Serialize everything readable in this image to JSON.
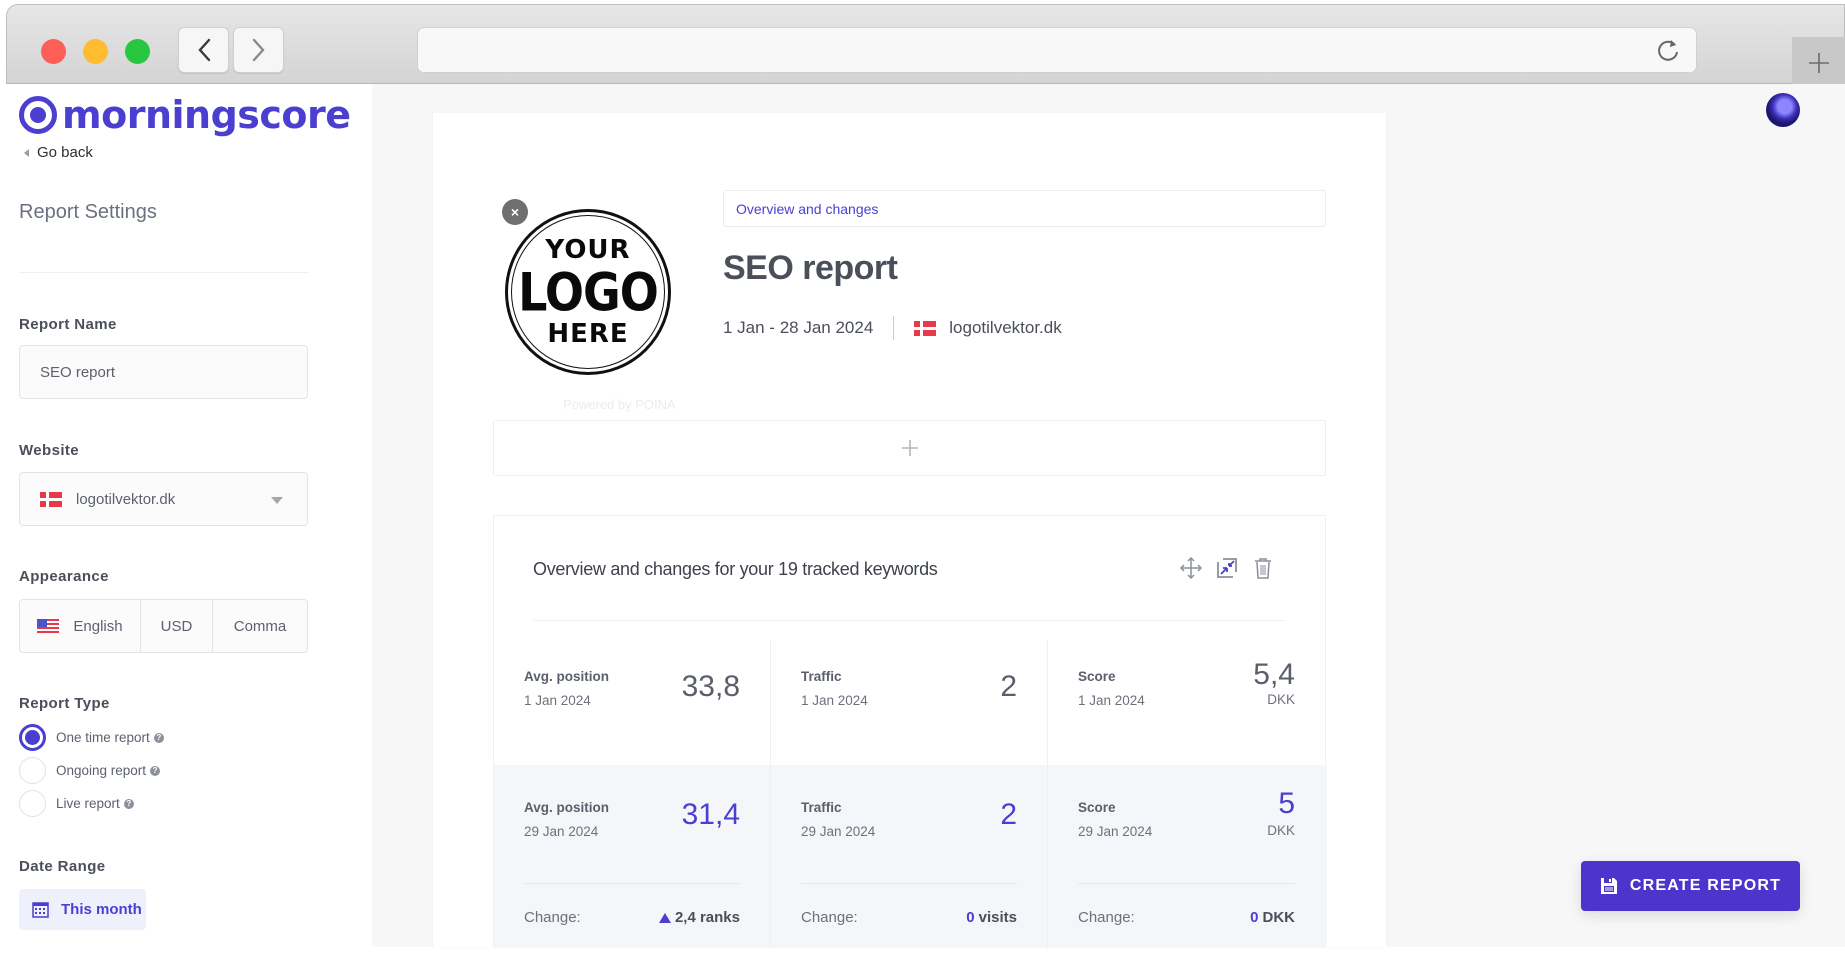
{
  "browser": {
    "back_icon": "chevron-left-icon",
    "forward_icon": "chevron-right-icon",
    "address_value": "",
    "reload_icon": "reload-icon",
    "new_tab_icon": "plus-icon"
  },
  "sidebar": {
    "brand": "morningscore",
    "go_back": "Go back",
    "section_title": "Report Settings",
    "report_name": {
      "label": "Report Name",
      "value": "SEO report"
    },
    "website": {
      "label": "Website",
      "value": "logotilvektor.dk",
      "flag": "dk-flag-icon"
    },
    "appearance": {
      "label": "Appearance",
      "language": "English",
      "currency": "USD",
      "decimal": "Comma"
    },
    "report_type": {
      "label": "Report Type",
      "options": [
        {
          "label": "One time report",
          "selected": true
        },
        {
          "label": "Ongoing report",
          "selected": false
        },
        {
          "label": "Live report",
          "selected": false
        }
      ],
      "help_glyph": "?"
    },
    "date_range": {
      "label": "Date Range",
      "value": "This month"
    }
  },
  "report": {
    "logo": {
      "line1": "YOUR",
      "line2": "LOGO",
      "line3": "HERE",
      "remove_glyph": "×"
    },
    "powered_by": "Powered by POINA",
    "tag": "Overview and changes",
    "title": "SEO report",
    "date_range": "1 Jan - 28 Jan 2024",
    "website": "logotilvektor.dk",
    "widget": {
      "title": "Overview and changes for your 19 tracked keywords",
      "tools": [
        "move-icon",
        "resize-icon",
        "trash-icon"
      ],
      "start": [
        {
          "name": "Avg. position",
          "date": "1 Jan 2024",
          "value": "33,8",
          "unit": ""
        },
        {
          "name": "Traffic",
          "date": "1 Jan 2024",
          "value": "2",
          "unit": ""
        },
        {
          "name": "Score",
          "date": "1 Jan 2024",
          "value": "5,4",
          "unit": "DKK"
        }
      ],
      "end": [
        {
          "name": "Avg. position",
          "date": "29 Jan 2024",
          "value": "31,4",
          "unit": "",
          "change_label": "Change:",
          "change_value": "2,4",
          "change_unit": "ranks",
          "trend": "up"
        },
        {
          "name": "Traffic",
          "date": "29 Jan 2024",
          "value": "2",
          "unit": "",
          "change_label": "Change:",
          "change_value": "0",
          "change_unit": "visits",
          "trend": "none"
        },
        {
          "name": "Score",
          "date": "29 Jan 2024",
          "value": "5",
          "unit": "DKK",
          "change_label": "Change:",
          "change_value": "0",
          "change_unit": "DKK",
          "trend": "none"
        }
      ]
    }
  },
  "actions": {
    "create_report": "CREATE REPORT"
  },
  "colors": {
    "accent": "#4a3fd0",
    "button": "#4d35cc",
    "flag_dk": "#e8394a"
  }
}
